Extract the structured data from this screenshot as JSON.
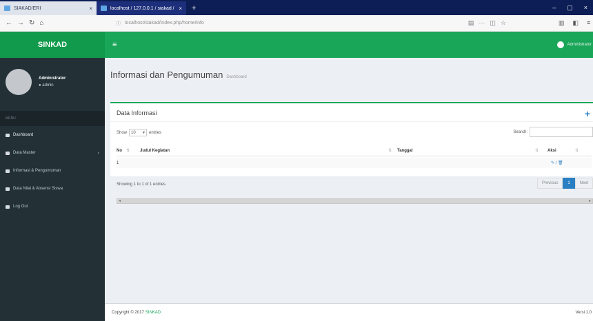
{
  "browser": {
    "tabs": [
      {
        "title": "SIAKAD/ERI",
        "active": false
      },
      {
        "title": "localhost / 127.0.0.1 / siakad / ...",
        "active": true
      }
    ],
    "new_tab": "+",
    "url": "localhost/siakad/index.php/home/info",
    "window_controls": [
      "–",
      "▢",
      "×"
    ]
  },
  "app": {
    "brand": "SINKAD",
    "menu_icon": "hamburger-icon",
    "top_user": "Administrator"
  },
  "sidebar": {
    "user_name": "Administrator",
    "user_status": "● admin",
    "header": "MENU",
    "items": [
      {
        "label": "Dashboard",
        "icon": "dashboard-icon"
      },
      {
        "label": "Data Master",
        "icon": "folder-icon",
        "caret": "‹"
      },
      {
        "label": "Informasi & Pengumuman",
        "icon": "info-icon"
      },
      {
        "label": "Data Nilai & Absensi Siswa",
        "icon": "book-icon"
      },
      {
        "label": "Log Out",
        "icon": "logout-icon"
      }
    ]
  },
  "page": {
    "title": "Informasi dan Pengumuman",
    "subtitle": "Dashboard"
  },
  "box": {
    "title": "Data Informasi",
    "add_icon": "+"
  },
  "table": {
    "show_label": "Show",
    "length_value": "10",
    "entries_label": "entries",
    "search_label": "Search:",
    "columns": [
      "No",
      "Judul Kegiatan",
      "Tanggal",
      "Aksi"
    ],
    "sort_icon": "⇅",
    "rows": [
      {
        "no": "1",
        "judul": "",
        "tanggal": "",
        "aksi": "✎ / 🗑"
      }
    ],
    "info": "Showing 1 to 1 of 1 entries",
    "pagination": [
      "Previous",
      "1",
      "Next"
    ]
  },
  "footer": {
    "copyright": "Copyright © 2017",
    "brand": "SINKAD",
    "version": "Versi 1.0"
  },
  "colors": {
    "primary_green": "#1aa659",
    "logo_green": "#119a4b",
    "sidebar_bg": "#233137",
    "accent_blue": "#2a7fc2"
  }
}
